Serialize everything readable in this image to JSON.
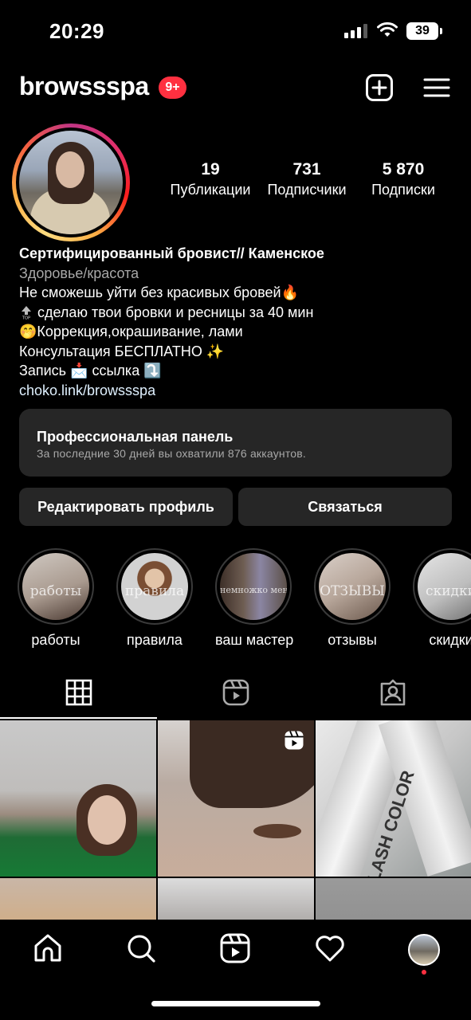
{
  "status_bar": {
    "time": "20:29",
    "battery": "39"
  },
  "header": {
    "username": "browssspa",
    "notifications_badge": "9+"
  },
  "stats": [
    {
      "value": "19",
      "label": "Публикации"
    },
    {
      "value": "731",
      "label": "Подписчики"
    },
    {
      "value": "5 870",
      "label": "Подписки"
    }
  ],
  "bio": {
    "name": "Сертифицированный бровист// Каменское",
    "category": "Здоровье/красота",
    "line1": "Не сможешь уйти без красивых бровей🔥",
    "line2": "сделаю твои бровки и ресницы за 40 мин",
    "line3": "🤭Коррекция,окрашивание, лами",
    "line4": "Консультация БЕСПЛАТНО ✨",
    "line5": "Запись 📩 ссылка ⤵️",
    "link": "choko.link/browssspa"
  },
  "pro_panel": {
    "title": "Профессиональная панель",
    "subtitle": "За последние 30 дней вы охватили 876 аккаунтов."
  },
  "buttons": {
    "edit": "Редактировать профиль",
    "contact": "Связаться"
  },
  "highlights": [
    {
      "label": "работы",
      "overlay": "работы"
    },
    {
      "label": "правила",
      "overlay": "правила"
    },
    {
      "label": "ваш мастер",
      "overlay": "немножко меня"
    },
    {
      "label": "отзывы",
      "overlay": "ОТЗЫВЫ"
    },
    {
      "label": "скидки",
      "overlay": "скидки"
    }
  ],
  "tabs": [
    "grid-icon",
    "reels-icon",
    "tagged-icon"
  ],
  "grid_posts": [
    {
      "type": "photo",
      "text": ""
    },
    {
      "type": "reel",
      "text": ""
    },
    {
      "type": "photo",
      "text": "LASH COLOR"
    }
  ],
  "bottom_nav": [
    "home-icon",
    "search-icon",
    "reels-icon",
    "heart-icon",
    "profile-avatar"
  ],
  "colors": {
    "badge": "#ff3040",
    "panel": "#262626",
    "background": "#000000"
  }
}
